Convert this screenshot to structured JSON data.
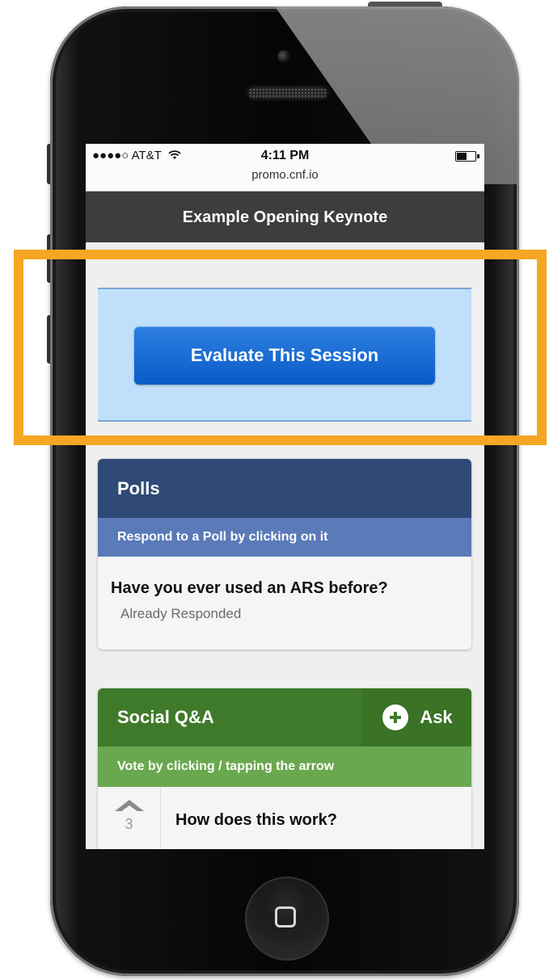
{
  "status_bar": {
    "carrier": "●●●●○ AT&T",
    "time": "4:11 PM",
    "url": "promo.cnf.io"
  },
  "nav": {
    "title": "Example Opening Keynote"
  },
  "evaluate": {
    "button_label": "Evaluate This Session"
  },
  "polls": {
    "title": "Polls",
    "subtitle": "Respond to a Poll by clicking on it",
    "items": [
      {
        "question": "Have you ever used an ARS before?",
        "status": "Already Responded"
      }
    ]
  },
  "social": {
    "title": "Social Q&A",
    "ask_label": "Ask",
    "subtitle": "Vote by clicking / tapping the arrow",
    "questions": [
      {
        "votes": "3",
        "text": "How does this work?"
      }
    ]
  },
  "colors": {
    "highlight": "#f5a623",
    "evaluate_button": "#0a5bc9",
    "polls_header": "#2f4a77",
    "social_header": "#3f7a2b"
  }
}
